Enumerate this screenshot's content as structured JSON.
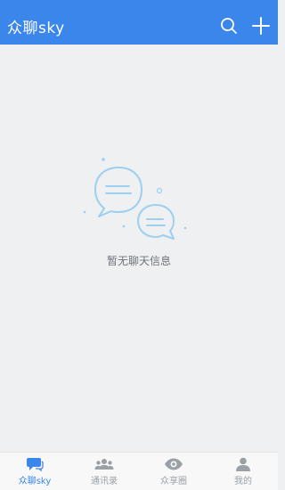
{
  "app": {
    "title": "众聊sky",
    "accent_color": "#3b86ea"
  },
  "header": {
    "search_icon": "search-icon",
    "add_icon": "plus-icon"
  },
  "empty_state": {
    "message": "暂无聊天信息",
    "illustration": "chat-bubbles-icon"
  },
  "tabs": [
    {
      "label": "众聊sky",
      "icon": "chat-bubble-icon",
      "active": true
    },
    {
      "label": "通讯录",
      "icon": "contacts-icon",
      "active": false
    },
    {
      "label": "众享圈",
      "icon": "eye-icon",
      "active": false
    },
    {
      "label": "我的",
      "icon": "user-icon",
      "active": false
    }
  ]
}
